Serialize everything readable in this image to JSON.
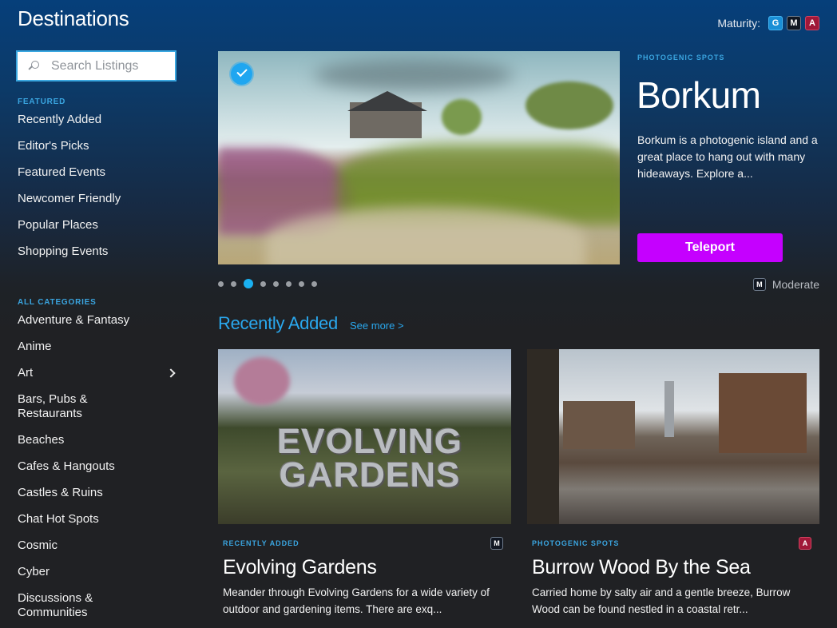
{
  "app": {
    "title": "Destinations"
  },
  "maturity": {
    "label": "Maturity:",
    "badges": [
      {
        "letter": "G",
        "name": "General",
        "color": "#1a8fd6"
      },
      {
        "letter": "M",
        "name": "Moderate",
        "color": "#111722"
      },
      {
        "letter": "A",
        "name": "Adult",
        "color": "#a01838"
      }
    ]
  },
  "search": {
    "placeholder": "Search Listings",
    "value": ""
  },
  "sidebar": {
    "featured_label": "FEATURED",
    "featured": [
      "Recently Added",
      "Editor's Picks",
      "Featured Events",
      "Newcomer Friendly",
      "Popular Places",
      "Shopping Events"
    ],
    "categories_label": "ALL CATEGORIES",
    "categories": [
      "Adventure & Fantasy",
      "Anime",
      "Art",
      "Bars, Pubs & Restaurants",
      "Beaches",
      "Cafes & Hangouts",
      "Castles & Ruins",
      "Chat Hot Spots",
      "Cosmic",
      "Cyber",
      "Discussions & Communities"
    ]
  },
  "hero": {
    "category": "PHOTOGENIC SPOTS",
    "title": "Borkum",
    "description": "Borkum is a photogenic island and a great place to hang out with many hideaways. Explore a...",
    "button_label": "Teleport",
    "verified": true,
    "rating_letter": "M",
    "rating_label": "Moderate",
    "slide_count": 8,
    "active_slide": 3,
    "accent": "#c500ff"
  },
  "recent": {
    "title": "Recently Added",
    "see_more": "See more >",
    "cards": [
      {
        "category": "RECENTLY ADDED",
        "rating": "M",
        "title": "Evolving Gardens",
        "image_text": "EVOLVING GARDENS",
        "description": "Meander through Evolving Gardens for a wide variety of outdoor and gardening items. There are exq..."
      },
      {
        "category": "PHOTOGENIC SPOTS",
        "rating": "A",
        "title": "Burrow Wood By the Sea",
        "description": "Carried home by salty air and a gentle breeze, Burrow Wood can be found nestled in a coastal retr..."
      }
    ]
  }
}
